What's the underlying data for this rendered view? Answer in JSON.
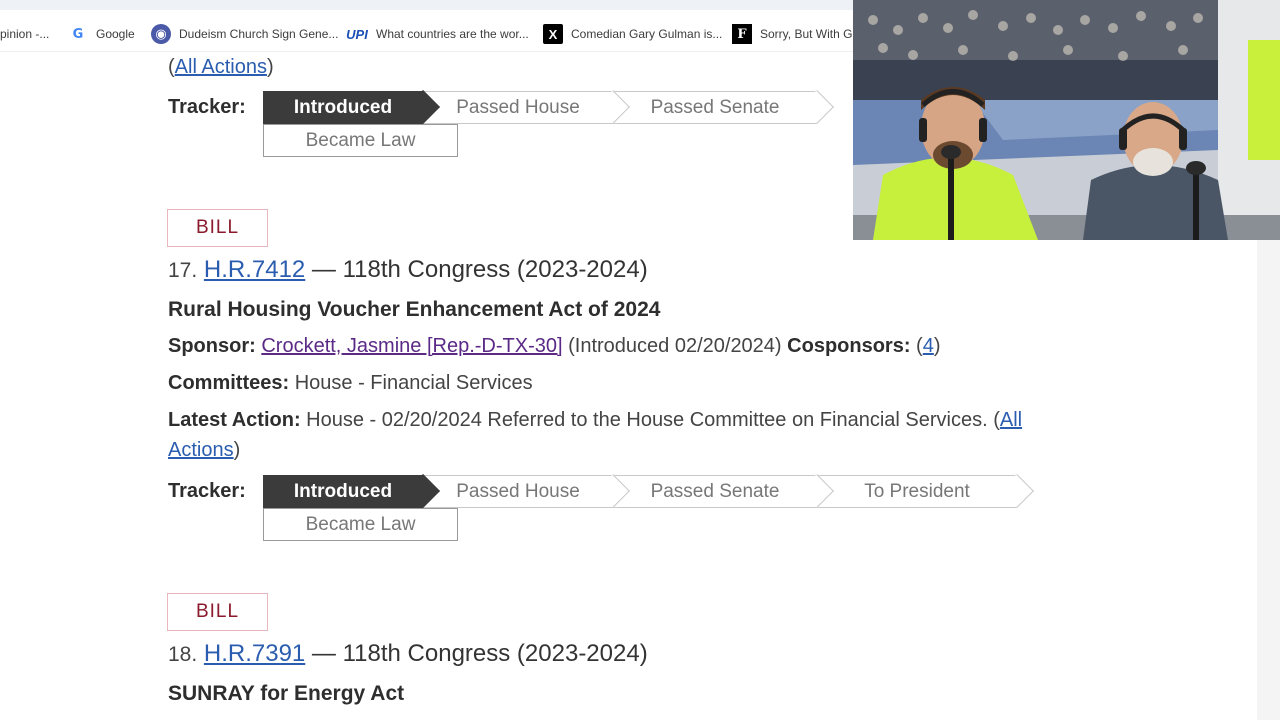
{
  "bookmarks": [
    {
      "label": "pinion -...",
      "icon": "page-icon"
    },
    {
      "label": "Google",
      "icon": "google-icon"
    },
    {
      "label": "Dudeism Church Sign Gene...",
      "icon": "dudeism-icon"
    },
    {
      "label": "What countries are the wor...",
      "icon": "upi-icon"
    },
    {
      "label": "Comedian Gary Gulman is...",
      "icon": "x-icon"
    },
    {
      "label": "Sorry, But With Gl",
      "icon": "f-icon"
    }
  ],
  "bookmark_icon_text": {
    "google": "G",
    "dudeism": "◉",
    "upi": "UPI",
    "x": "X",
    "f": "F"
  },
  "prev_result": {
    "all_actions_open": "(",
    "all_actions": "All Actions",
    "all_actions_close": ")",
    "tracker_label": "Tracker:",
    "steps": [
      "Introduced",
      "Passed House",
      "Passed Senate"
    ],
    "became_law": "Became Law"
  },
  "result17": {
    "badge": "BILL",
    "number": "17.",
    "bill_id": "H.R.7412",
    "congress": " — 118th Congress (2023-2024)",
    "title": "Rural Housing Voucher Enhancement Act of 2024",
    "sponsor_label": "Sponsor:",
    "sponsor": "Crockett, Jasmine [Rep.-D-TX-30]",
    "introduced": " (Introduced 02/20/2024) ",
    "cosponsors_label": "Cosponsors:",
    "cosponsors_count": "4",
    "committees_label": "Committees:",
    "committees": " House - Financial Services",
    "latest_action_label": "Latest Action:",
    "latest_action": " House - 02/20/2024 Referred to the House Committee on Financial Services. (",
    "all_actions_1": "All",
    "all_actions_2": "Actions",
    "tracker_label": "Tracker:",
    "steps": [
      "Introduced",
      "Passed House",
      "Passed Senate",
      "To President"
    ],
    "became_law": "Became Law"
  },
  "result18": {
    "badge": "BILL",
    "number": "18.",
    "bill_id": "H.R.7391",
    "congress": " — 118th Congress (2023-2024)",
    "title": "SUNRAY for Energy Act"
  },
  "colors": {
    "link": "#2a5db0",
    "visited": "#5b2a86",
    "badge": "#8a1a2c",
    "tracker_active": "#3b3b3b"
  }
}
